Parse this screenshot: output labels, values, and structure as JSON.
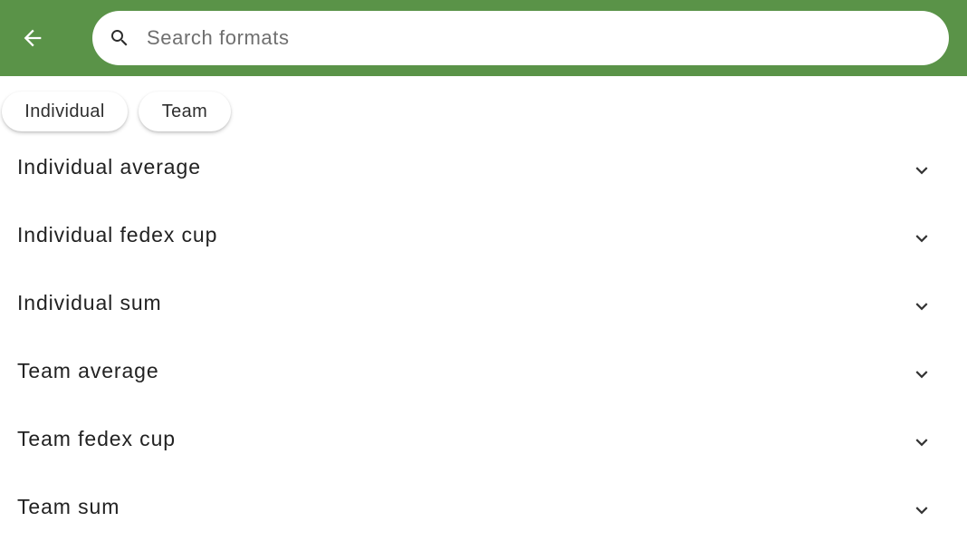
{
  "colors": {
    "appbar": "#5a9348",
    "text": "#222222",
    "placeholder": "#6f6f6f"
  },
  "header": {
    "back_icon": "arrow-back-icon",
    "search": {
      "icon": "search-icon",
      "placeholder": "Search formats",
      "value": ""
    }
  },
  "filters": {
    "chips": [
      {
        "label": "Individual"
      },
      {
        "label": "Team"
      }
    ]
  },
  "formats": {
    "items": [
      {
        "label": "Individual average",
        "icon": "chevron-down-icon"
      },
      {
        "label": "Individual fedex cup",
        "icon": "chevron-down-icon"
      },
      {
        "label": "Individual sum",
        "icon": "chevron-down-icon"
      },
      {
        "label": "Team average",
        "icon": "chevron-down-icon"
      },
      {
        "label": "Team fedex cup",
        "icon": "chevron-down-icon"
      },
      {
        "label": "Team sum",
        "icon": "chevron-down-icon"
      }
    ]
  }
}
